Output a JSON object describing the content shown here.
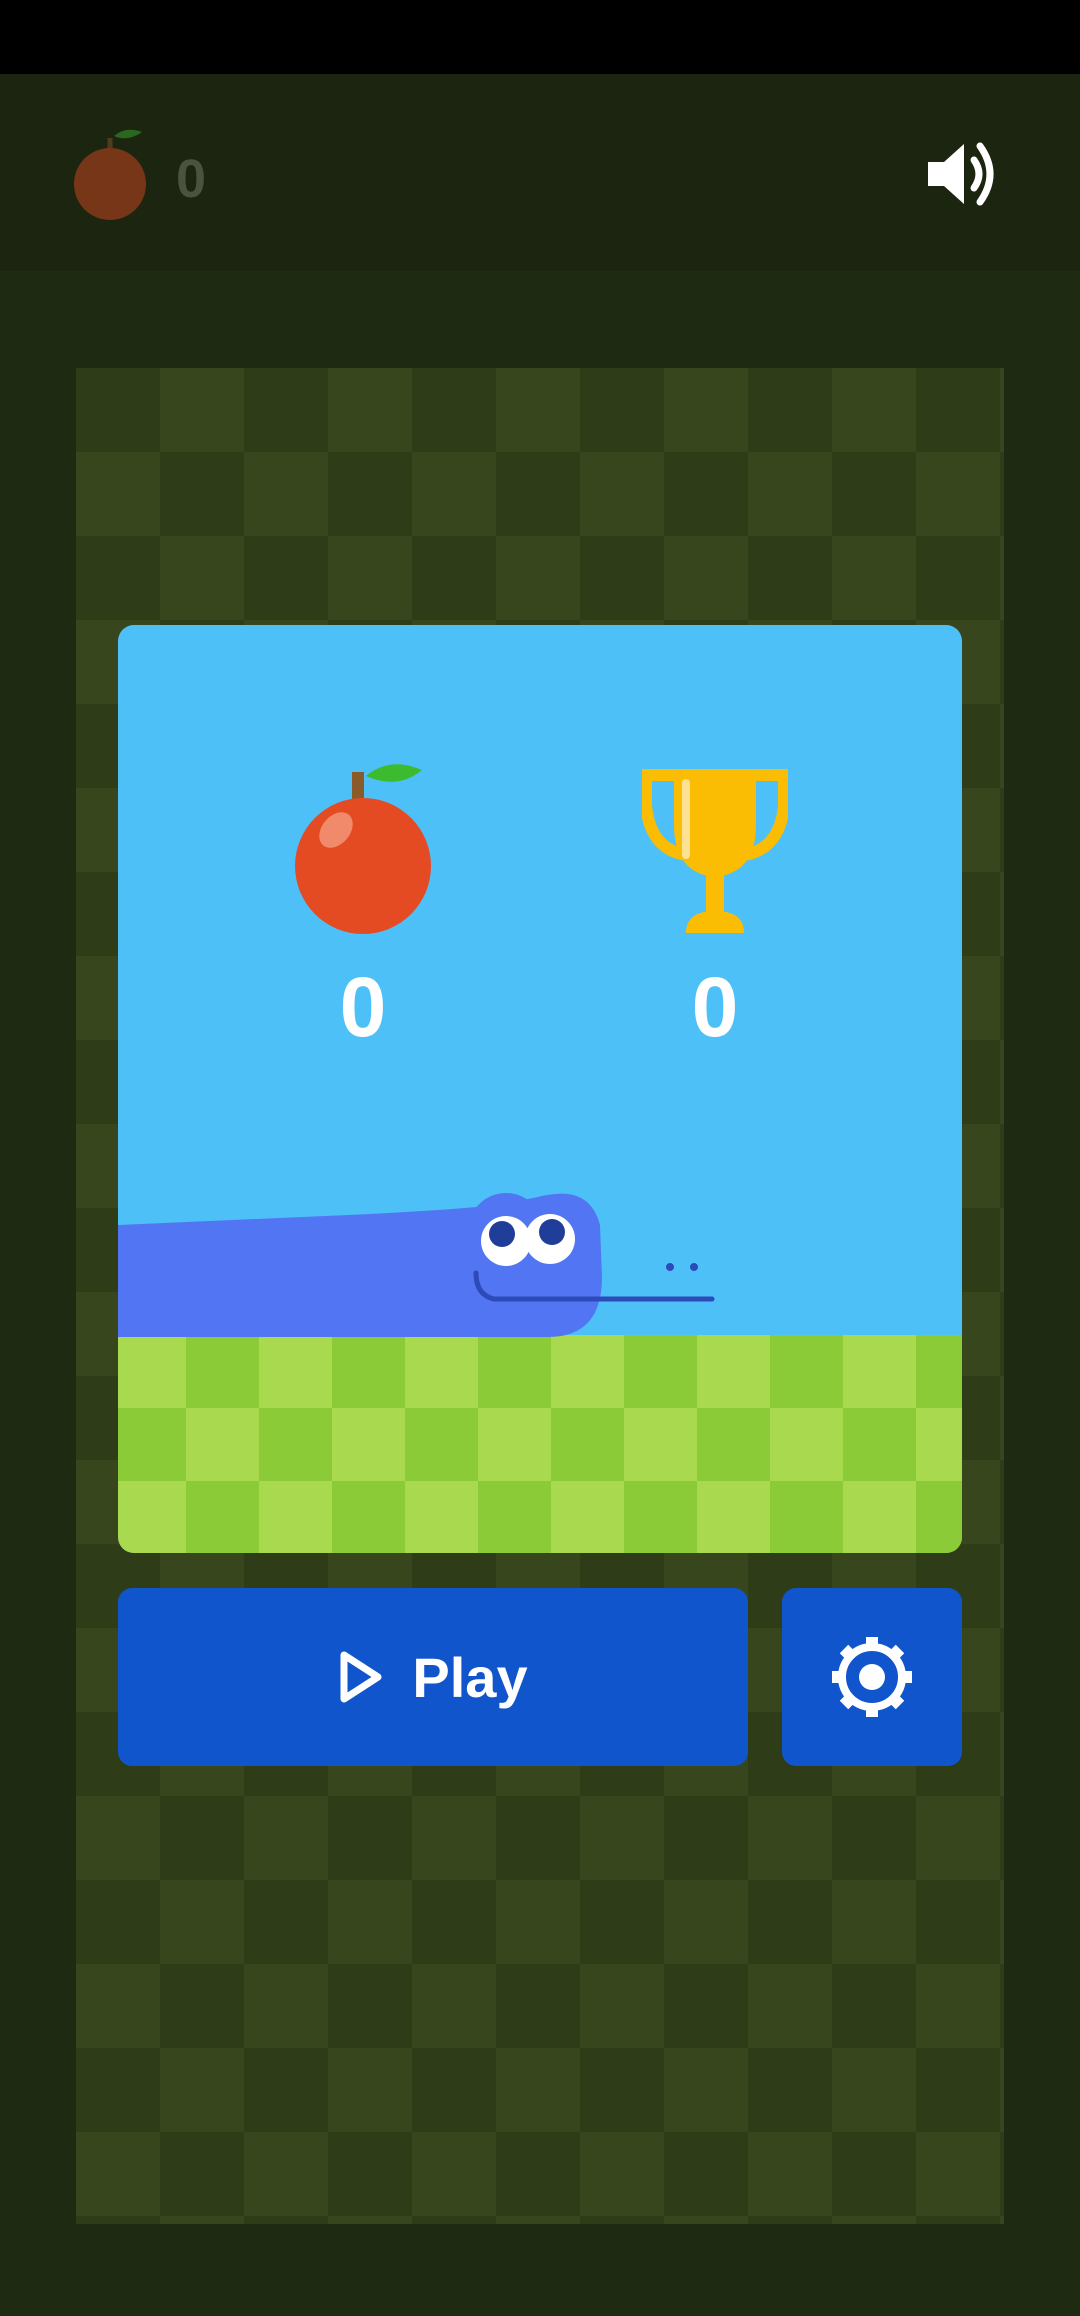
{
  "header": {
    "apple_icon": "apple-icon",
    "score": "0",
    "sound_icon": "speaker-icon"
  },
  "card": {
    "apple_icon": "apple-icon",
    "apple_score": "0",
    "trophy_icon": "trophy-icon",
    "best_score": "0"
  },
  "buttons": {
    "play_label": "Play",
    "play_icon": "play-icon",
    "settings_icon": "gear-icon"
  },
  "colors": {
    "background": "#1f2a12",
    "sky": "#4dc0f7",
    "grass_light": "#a9d94e",
    "grass_dark": "#8ccb38",
    "snake": "#5276f3",
    "apple": "#e54b22",
    "trophy": "#fbbc04",
    "button": "#1155cc"
  }
}
